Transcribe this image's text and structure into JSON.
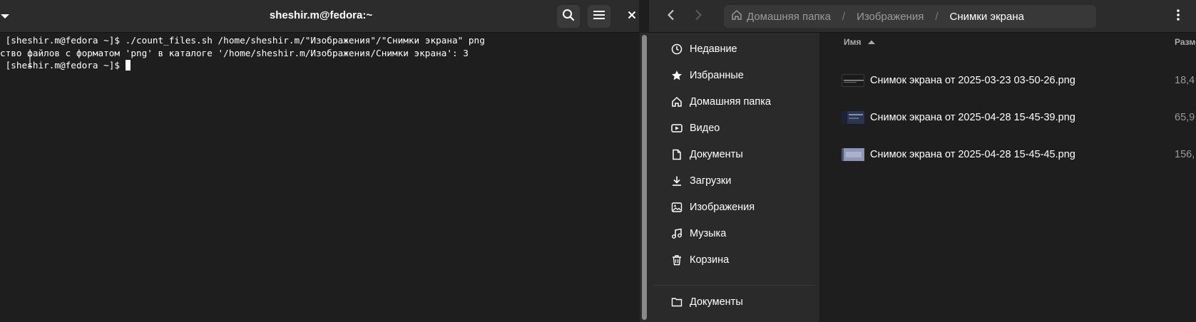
{
  "terminal": {
    "title": "sheshir.m@fedora:~",
    "lines": [
      " [sheshir.m@fedora ~]$ ./count_files.sh /home/sheshir.m/\"Изображения\"/\"Снимки экрана\" png",
      "ство файлов с форматом 'png' в каталоге '/home/sheshir.m/Изображения/Снимки экрана': 3",
      " [sheshir.m@fedora ~]$ "
    ],
    "icons": {
      "tab_menu": "chevron-down-icon",
      "search": "search-icon",
      "menu": "hamburger-menu-icon",
      "close": "close-icon"
    }
  },
  "files": {
    "path": {
      "home": "Домашняя папка",
      "images": "Изображения",
      "current": "Снимки экрана"
    },
    "sidebar": [
      {
        "label": "Недавние",
        "icon": "clock-icon"
      },
      {
        "label": "Избранные",
        "icon": "star-icon"
      },
      {
        "label": "Домашняя папка",
        "icon": "home-icon"
      },
      {
        "label": "Видео",
        "icon": "video-icon"
      },
      {
        "label": "Документы",
        "icon": "document-icon"
      },
      {
        "label": "Загрузки",
        "icon": "download-icon"
      },
      {
        "label": "Изображения",
        "icon": "image-icon"
      },
      {
        "label": "Музыка",
        "icon": "music-icon"
      },
      {
        "label": "Корзина",
        "icon": "trash-icon"
      },
      {
        "label": "Документы",
        "icon": "folder-icon"
      }
    ],
    "columns": {
      "name": "Имя",
      "size": "Разме"
    },
    "rows": [
      {
        "name": "Снимок экрана от 2025-03-23 03-50-26.png",
        "size": "18,4"
      },
      {
        "name": "Снимок экрана от 2025-04-28 15-45-39.png",
        "size": "65,9"
      },
      {
        "name": "Снимок экрана от 2025-04-28 15-45-45.png",
        "size": "156,"
      }
    ]
  },
  "colors": {
    "header": "#2c2c2c",
    "sidebar": "#2a2a2a",
    "background": "#1e1e1e",
    "path_bar": "#383838"
  }
}
